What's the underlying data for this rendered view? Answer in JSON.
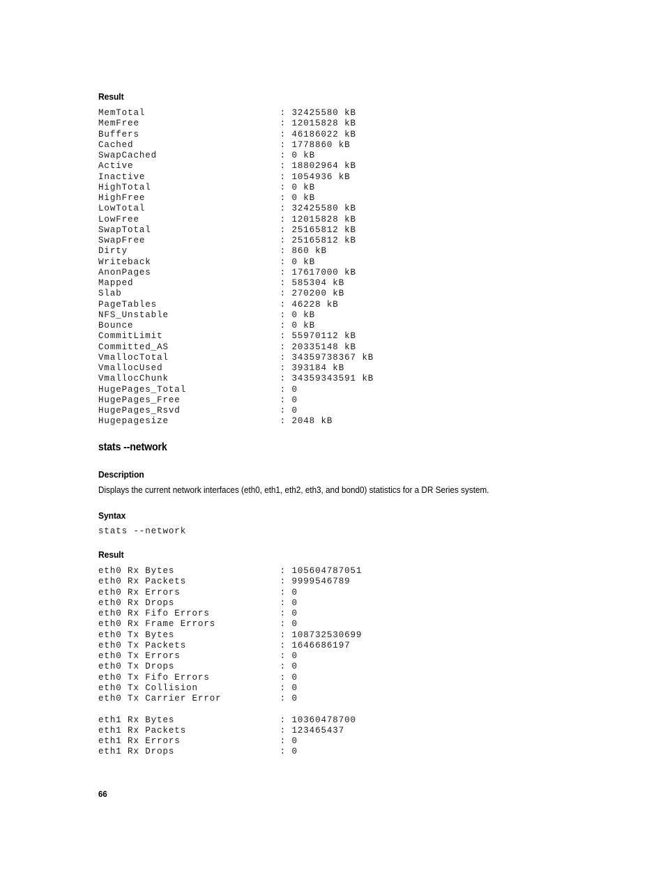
{
  "page": {
    "number": "66"
  },
  "memory_section": {
    "result_heading": "Result",
    "rows": [
      {
        "key": "MemTotal",
        "value": "32425580 kB"
      },
      {
        "key": "MemFree",
        "value": "12015828 kB"
      },
      {
        "key": "Buffers",
        "value": "46186022 kB"
      },
      {
        "key": "Cached",
        "value": "1778860 kB"
      },
      {
        "key": "SwapCached",
        "value": "0 kB"
      },
      {
        "key": "Active",
        "value": "18802964 kB"
      },
      {
        "key": "Inactive",
        "value": "1054936 kB"
      },
      {
        "key": "HighTotal",
        "value": "0 kB"
      },
      {
        "key": "HighFree",
        "value": "0 kB"
      },
      {
        "key": "LowTotal",
        "value": "32425580 kB"
      },
      {
        "key": "LowFree",
        "value": "12015828 kB"
      },
      {
        "key": "SwapTotal",
        "value": "25165812 kB"
      },
      {
        "key": "SwapFree",
        "value": "25165812 kB"
      },
      {
        "key": "Dirty",
        "value": "860 kB"
      },
      {
        "key": "Writeback",
        "value": "0 kB"
      },
      {
        "key": "AnonPages",
        "value": "17617000 kB"
      },
      {
        "key": "Mapped",
        "value": "585304 kB"
      },
      {
        "key": "Slab",
        "value": "270200 kB"
      },
      {
        "key": "PageTables",
        "value": "46228 kB"
      },
      {
        "key": "NFS_Unstable",
        "value": "0 kB"
      },
      {
        "key": "Bounce",
        "value": "0 kB"
      },
      {
        "key": "CommitLimit",
        "value": "55970112 kB"
      },
      {
        "key": "Committed_AS",
        "value": "20335148 kB"
      },
      {
        "key": "VmallocTotal",
        "value": "34359738367 kB"
      },
      {
        "key": "VmallocUsed",
        "value": "393184 kB"
      },
      {
        "key": "VmallocChunk",
        "value": "34359343591 kB"
      },
      {
        "key": "HugePages_Total",
        "value": "0"
      },
      {
        "key": "HugePages_Free",
        "value": "0"
      },
      {
        "key": "HugePages_Rsvd",
        "value": "0"
      },
      {
        "key": "Hugepagesize",
        "value": "2048 kB"
      }
    ]
  },
  "network_section": {
    "title": "stats --network",
    "description_heading": "Description",
    "description_text": "Displays the current network interfaces (eth0, eth1, eth2, eth3, and bond0) statistics for a DR Series system.",
    "syntax_heading": "Syntax",
    "syntax_code": "stats --network",
    "result_heading": "Result",
    "rows": [
      {
        "key": "eth0 Rx Bytes",
        "value": "105604787051"
      },
      {
        "key": "eth0 Rx Packets",
        "value": "9999546789"
      },
      {
        "key": "eth0 Rx Errors",
        "value": "0"
      },
      {
        "key": "eth0 Rx Drops",
        "value": "0"
      },
      {
        "key": "eth0 Rx Fifo Errors",
        "value": "0"
      },
      {
        "key": "eth0 Rx Frame Errors",
        "value": "0"
      },
      {
        "key": "eth0 Tx Bytes",
        "value": "108732530699"
      },
      {
        "key": "eth0 Tx Packets",
        "value": "1646686197"
      },
      {
        "key": "eth0 Tx Errors",
        "value": "0"
      },
      {
        "key": "eth0 Tx Drops",
        "value": "0"
      },
      {
        "key": "eth0 Tx Fifo Errors",
        "value": "0"
      },
      {
        "key": "eth0 Tx Collision",
        "value": "0"
      },
      {
        "key": "eth0 Tx Carrier Error",
        "value": "0"
      },
      {
        "key": "",
        "value": ""
      },
      {
        "key": "eth1 Rx Bytes",
        "value": "10360478700"
      },
      {
        "key": "eth1 Rx Packets",
        "value": "123465437"
      },
      {
        "key": "eth1 Rx Errors",
        "value": "0"
      },
      {
        "key": "eth1 Rx Drops",
        "value": "0"
      }
    ]
  },
  "layout": {
    "key_column_chars": 31,
    "separator": ":"
  }
}
